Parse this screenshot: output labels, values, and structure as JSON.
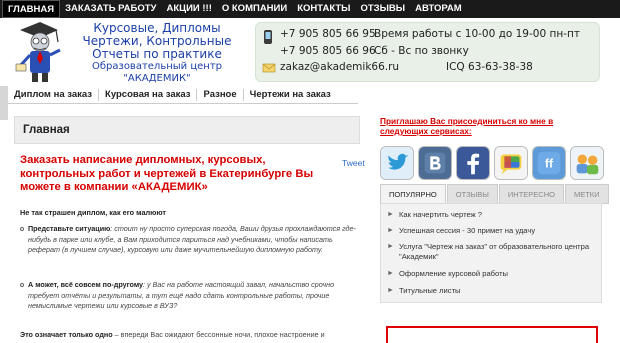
{
  "top_nav": [
    "ГЛАВНАЯ",
    "ЗАКАЗАТЬ РАБОТУ",
    "АКЦИИ !!!",
    "О КОМПАНИИ",
    "КОНТАКТЫ",
    "ОТЗЫВЫ",
    "АВТОРАМ"
  ],
  "logo": {
    "line1": "Курсовые, Дипломы",
    "line2": "Чертежи, Контрольные",
    "line3": "Отчеты по практике",
    "line4": "Образовательный центр \"АКАДЕМИК\""
  },
  "contacts": {
    "phone1": "+7 905 805 66 95",
    "hours1": "Время работы с 10-00 до 19-00 пн-пт",
    "phone2": "+7 905 805 66 96",
    "hours2": "Сб - Вс по звонку",
    "email": "zakaz@akademik66.ru",
    "icq": "ICQ 63-63-38-38"
  },
  "sub_nav": [
    "Диплом на заказ",
    "Курсовая на заказ",
    "Разное",
    "Чертежи на заказ"
  ],
  "main": {
    "page_title": "Главная",
    "tweet": "Tweet",
    "headline": "Заказать написание дипломных, курсовых, контрольных работ и чертежей в Екатеринбурге Вы можете в компании «АКАДЕМИК»",
    "intro": "Не так страшен диплом, как его малюют",
    "bullet1_bold": "Представьте ситуацию",
    "bullet1_text": ": стоит ну просто суперская погода, Ваши друзья прохлаждаются где-нибудь в парке или клубе, а Вам приходится париться над учебниками, чтобы написать реферат (в лучшем случае), курсовую или даже мучительнейшую дипломную работу.",
    "bullet2_bold": "А может, всё совсем по-другому",
    "bullet2_text": ": у Вас на работе настоящий завал, начальство срочно требует отчёты и результаты, а тут ещё надо сдать контрольные работы, прочие немыслимые чертежи или курсовые в ВУЗ?",
    "bottom_bold": "Это означает только одно",
    "bottom_text": " – впереди Вас ожидают бессонные ночи, плохое настроение и"
  },
  "sidebar": {
    "invite": "Приглашаю Вас присоединиться ко мне в следующих сервисах:",
    "social": [
      "twitter",
      "vkontakte",
      "facebook",
      "google-buzz",
      "friendfeed",
      "moi-mir"
    ],
    "tabs": [
      "ПОПУЛЯРНО",
      "ОТЗЫВЫ",
      "ИНТЕРЕСНО",
      "МЕТКИ"
    ],
    "posts": [
      "Как начертить чертеж ?",
      "Успешная сессия - 30 примет на удачу",
      "Услуга \"Чертеж на заказ\" от образовательного центра \"Академик\"",
      "Оформление курсовой работы",
      "Титульные листы"
    ]
  },
  "colors": {
    "accent_red": "#d60000",
    "brand_blue": "#1b3fa6",
    "nav_bg": "#1a1a1a"
  }
}
